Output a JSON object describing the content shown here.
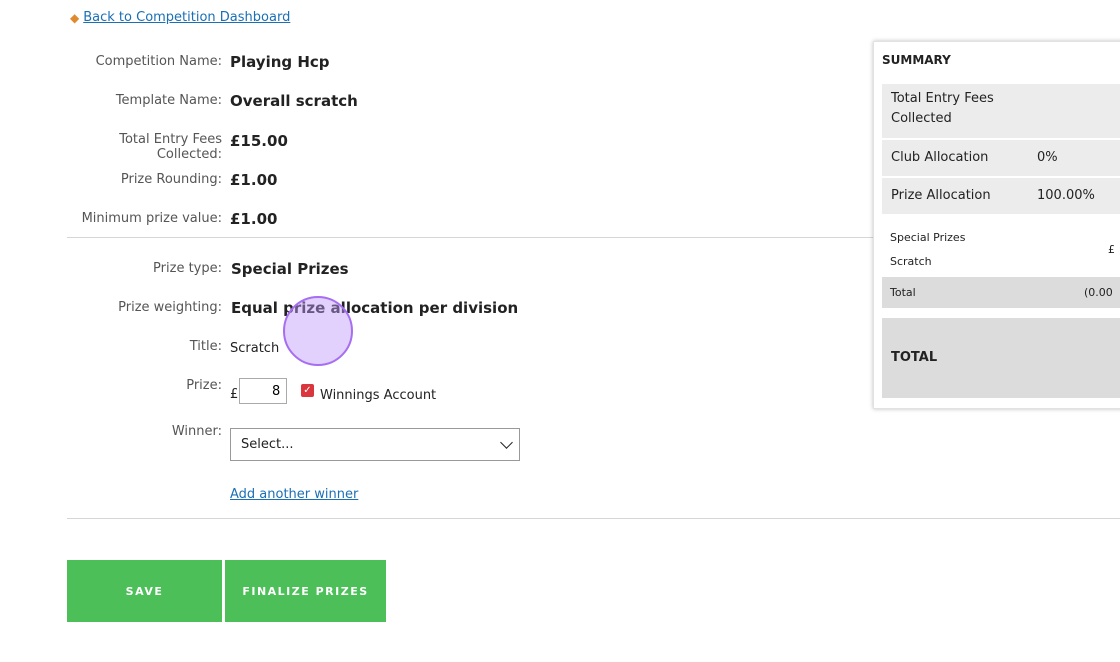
{
  "nav": {
    "back_label": "Back to Competition Dashboard"
  },
  "fields": {
    "competition_name": {
      "label": "Competition Name:",
      "value": "Playing Hcp"
    },
    "template_name": {
      "label": "Template Name:",
      "value": "Overall scratch"
    },
    "total_entry_fees": {
      "label_line1": "Total Entry Fees",
      "label_line2": "Collected:",
      "value": "£15.00"
    },
    "prize_rounding": {
      "label": "Prize Rounding:",
      "value": "£1.00"
    },
    "minimum_prize": {
      "label": "Minimum prize value:",
      "value": "£1.00"
    },
    "prize_type": {
      "label": "Prize type:",
      "value": "Special Prizes"
    },
    "prize_weighting": {
      "label": "Prize weighting:",
      "value": "Equal prize allocation per division"
    },
    "title": {
      "label": "Title:",
      "value": "Scratch"
    },
    "prize": {
      "label": "Prize:",
      "currency": "£",
      "value": "8",
      "winnings_label": "Winnings Account",
      "winnings_checked": true
    },
    "winner": {
      "label": "Winner:",
      "selected": "Select..."
    }
  },
  "actions": {
    "add_winner": "Add another winner",
    "save": "SAVE",
    "finalize": "FINALIZE PRIZES"
  },
  "summary": {
    "title": "SUMMARY",
    "total_entry_fees_line1": "Total Entry Fees",
    "total_entry_fees_line2": "Collected",
    "club_allocation_label": "Club Allocation",
    "club_allocation_value": "0%",
    "prize_allocation_label": "Prize Allocation",
    "prize_allocation_value": "100.00%",
    "special_prizes_label": "Special Prizes",
    "special_prizes_amount_partial": "£",
    "scratch_label": "Scratch",
    "inner_total_label": "Total",
    "inner_total_value_partial": "(0.00",
    "total_label": "TOTAL"
  },
  "colors": {
    "accent_green": "#4cbf59",
    "link_blue": "#1a6fb5",
    "checkbox_red": "#d9363e"
  }
}
